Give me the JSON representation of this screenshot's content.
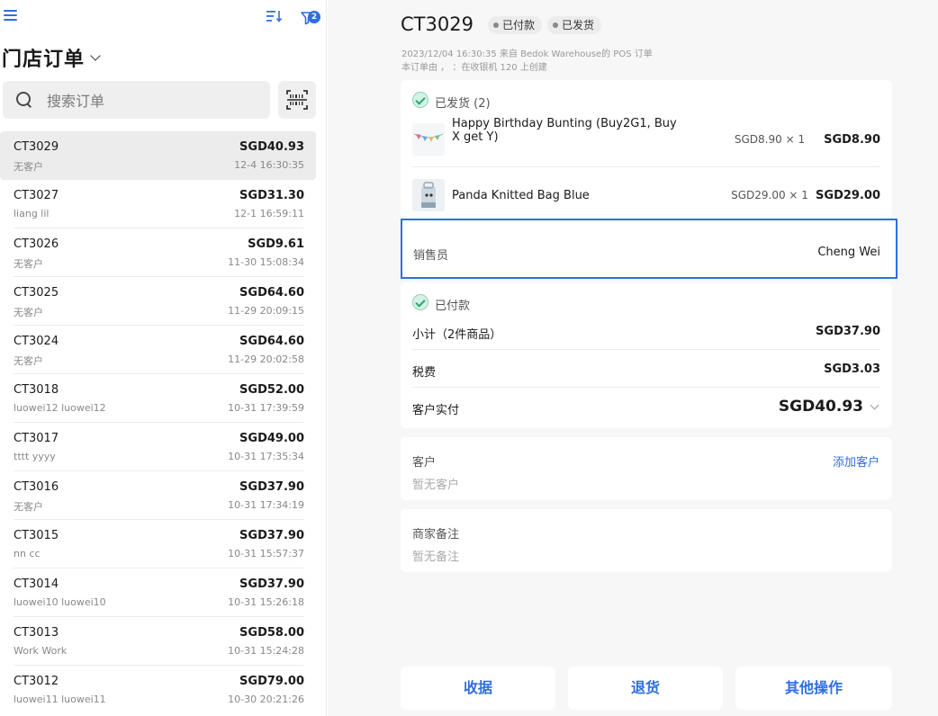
{
  "app": {
    "title": "门店订单",
    "filter_badge": "2"
  },
  "search": {
    "placeholder": "搜索订单"
  },
  "orders": [
    {
      "id": "CT3029",
      "amount": "SGD40.93",
      "customer": "无客户",
      "time": "12-4 16:30:35",
      "selected": true
    },
    {
      "id": "CT3027",
      "amount": "SGD31.30",
      "customer": "liang lil",
      "time": "12-1 16:59:11"
    },
    {
      "id": "CT3026",
      "amount": "SGD9.61",
      "customer": "无客户",
      "time": "11-30 15:08:34"
    },
    {
      "id": "CT3025",
      "amount": "SGD64.60",
      "customer": "无客户",
      "time": "11-29 20:09:15"
    },
    {
      "id": "CT3024",
      "amount": "SGD64.60",
      "customer": "无客户",
      "time": "11-29 20:02:58"
    },
    {
      "id": "CT3018",
      "amount": "SGD52.00",
      "customer": "luowei12 luowei12",
      "time": "10-31 17:39:59"
    },
    {
      "id": "CT3017",
      "amount": "SGD49.00",
      "customer": "tttt yyyy",
      "time": "10-31 17:35:34"
    },
    {
      "id": "CT3016",
      "amount": "SGD37.90",
      "customer": "无客户",
      "time": "10-31 17:34:19"
    },
    {
      "id": "CT3015",
      "amount": "SGD37.90",
      "customer": "nn cc",
      "time": "10-31 15:57:37"
    },
    {
      "id": "CT3014",
      "amount": "SGD37.90",
      "customer": "luowei10 luowei10",
      "time": "10-31 15:26:18"
    },
    {
      "id": "CT3013",
      "amount": "SGD58.00",
      "customer": "Work Work",
      "time": "10-31 15:24:28"
    },
    {
      "id": "CT3012",
      "amount": "SGD79.00",
      "customer": "luowei11 luowei11",
      "time": "10-30 20:21:26"
    }
  ],
  "detail": {
    "order_id": "CT3029",
    "tags": [
      "已付款",
      "已发货"
    ],
    "meta_line1": "2023/12/04 16:30:35 来自 Bedok Warehouse的 POS 订单",
    "meta_line2": "本订单由 ， ：在收银机 120 上创建",
    "shipped_label": "已发货 (2)",
    "items": [
      {
        "name": "Happy Birthday Bunting (Buy2G1, Buy X get Y)",
        "unit": "SGD8.90 × 1",
        "total": "SGD8.90"
      },
      {
        "name": "Panda Knitted Bag Blue",
        "unit": "SGD29.00 × 1",
        "total": "SGD29.00"
      }
    ],
    "salesperson_label": "销售员",
    "salesperson": "Cheng Wei",
    "paid_label": "已付款",
    "subtotal_label": "小计（2件商品）",
    "subtotal": "SGD37.90",
    "tax_label": "税费",
    "tax": "SGD3.03",
    "paid_total_label": "客户实付",
    "paid_total": "SGD40.93",
    "customer_label": "客户",
    "add_customer": "添加客户",
    "no_customer": "暂无客户",
    "note_label": "商家备注",
    "no_note": "暂无备注"
  },
  "actions": {
    "receipt": "收据",
    "refund": "退货",
    "more": "其他操作"
  },
  "colors": {
    "accent": "#2f6fe0",
    "success": "#2aa672"
  }
}
